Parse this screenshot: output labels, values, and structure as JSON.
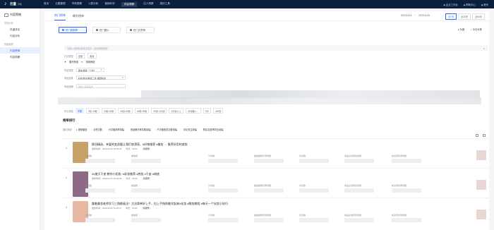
{
  "topbar": {
    "logo_text": "巨量",
    "logo_sub": "算数",
    "nav": [
      "首页",
      "云图管理",
      "市场洞察",
      "人群分析",
      "营销科学",
      "内容洞察",
      "达人洞察",
      "规划工具"
    ],
    "active_index": 5,
    "right": [
      "企业工作台",
      "帮助中心",
      "账号"
    ]
  },
  "sidebar": {
    "header": "内容策略",
    "groups": [
      {
        "title": "市场分析",
        "items": [
          "热度排名"
        ]
      },
      {
        "title": "",
        "items": [
          "内容分析"
        ]
      },
      {
        "title": "热度趋势",
        "items": [
          "内容榜单",
          "内容洞察"
        ]
      }
    ],
    "active_item": "内容榜单"
  },
  "tabs": [
    "热门榜单",
    "飙升榜单"
  ],
  "active_tab": "热门榜单",
  "date_range": [
    "2022/11/19",
    "2022/11/25"
  ],
  "range_buttons": [
    "近7天",
    "近30天",
    "近90天"
  ],
  "categories": [
    "热门视频榜",
    "热门图片",
    "热门文章榜"
  ],
  "active_category": "热门视频榜",
  "radio": [
    "抖音",
    "今日头条"
  ],
  "search_placeholder": "请输入视频标题或关键词（支持模糊搜索）",
  "filters": {
    "industry_label": "行业类型",
    "industry_chips": [
      "全部",
      "美妆"
    ],
    "expand": "展开筛选",
    "reset": "重置筛选",
    "region_label": "内容类型",
    "region_value": "美妆/美容（个护）",
    "product_label": "商品品类",
    "product_value": "彩妆/香水/美妆工具>面部彩妆",
    "brand_label": "商品品牌",
    "brand_placeholder": "请输入商品品牌",
    "duration_label": "时长筛选",
    "duration_chips": [
      "不限",
      "0秒-15秒",
      "15秒-30秒",
      "30秒-60秒",
      "60秒-90秒",
      "90秒-3分钟",
      "3分钟以上",
      "手动输入：",
      "0分",
      "400秒"
    ]
  },
  "list": {
    "title": "榜单排行",
    "metric_label": "指标筛选",
    "metrics": [
      "视频播放",
      "点赞次数",
      "分享播放率增幅",
      "商品曝光率实数增幅",
      "千次播放成交数增幅",
      "评论关注增幅",
      "购买意愿率同比增幅"
    ],
    "active_metric": "视频播放",
    "columns": [
      "点赞数",
      "播放量",
      "分享数",
      "播放量曝光率增幅",
      "评论数",
      "商品点击转化增幅",
      "成交转化率增幅",
      "千次播放成交率增幅"
    ],
    "rows": [
      {
        "rank": "1",
        "title": "欧冠精选，亲爱的女孩要让我们穿漂亮，#好物推荐 #美妆 … 推荐好用的底妆",
        "publish": "发布时间：2022/11/21 16:09:23",
        "tag": "抖音号",
        "duration": "时长：00:57",
        "thumb_color": "#c9a26a"
      },
      {
        "rank": "2",
        "title": "25度大干皮 教你小奶肌~#彩妆推荐 #底妆 #干皮 #粉底",
        "publish": "发布时间：2022/11/17 20:00:00",
        "tag": "抖音号",
        "duration": "时长：00:45",
        "thumb_color": "#8e6a86"
      },
      {
        "rank": "3",
        "title": "跟着美妆老师学习三角眼画法！方法简单好上手，拉上手指闹着学起来#化妆 #眼妆教程 #每天一个化妆小技巧",
        "publish": "发布时间：2022/11/30 11:46:27",
        "tag": "抖音号",
        "duration": "时长：00:52",
        "thumb_color": "#e6b8a2"
      }
    ]
  }
}
